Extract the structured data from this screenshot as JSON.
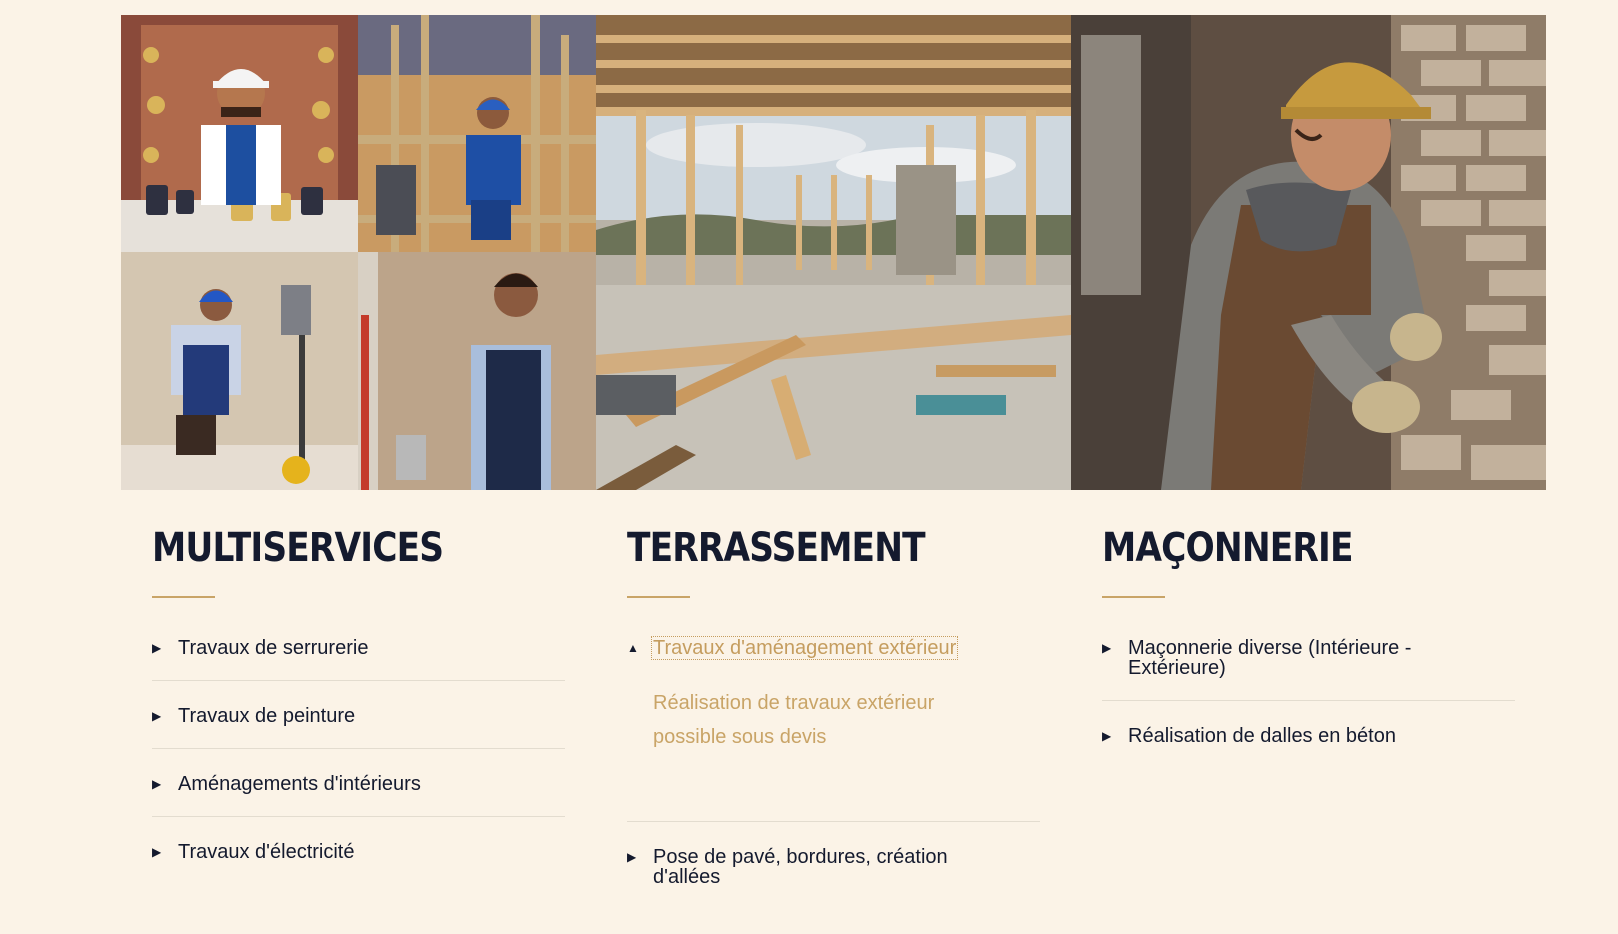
{
  "colors": {
    "background": "#fbf3e7",
    "heading": "#141a2e",
    "accent": "#c9a467",
    "separator": "#e3dccf"
  },
  "images": [
    {
      "name": "multiservices-collage-image",
      "subjects": [
        "locksmith",
        "plumber",
        "electrician",
        "painter"
      ]
    },
    {
      "name": "timber-framing-site-image",
      "subjects": [
        "wooden frame",
        "construction site"
      ]
    },
    {
      "name": "bricklayer-image",
      "subjects": [
        "mason",
        "brick wall"
      ]
    }
  ],
  "columns": [
    {
      "title": "MULTISERVICES",
      "items": [
        {
          "label": "Travaux de serrurerie",
          "open": false,
          "icon": "caret-right-icon"
        },
        {
          "label": "Travaux de peinture",
          "open": false,
          "icon": "caret-right-icon"
        },
        {
          "label": "Aménagements d'intérieurs",
          "open": false,
          "icon": "caret-right-icon"
        },
        {
          "label": "Travaux d'électricité",
          "open": false,
          "icon": "caret-right-icon"
        }
      ]
    },
    {
      "title": "TERRASSEMENT",
      "items": [
        {
          "label": "Travaux d'aménagement extérieur",
          "open": true,
          "icon": "caret-up-icon",
          "body": "Réalisation de travaux extérieur possible sous devis"
        },
        {
          "label": "Pose de pavé, bordures, création d'allées",
          "open": false,
          "icon": "caret-right-icon"
        }
      ]
    },
    {
      "title": "MAÇONNERIE",
      "items": [
        {
          "label": "Maçonnerie diverse (Intérieure - Extérieure)",
          "open": false,
          "icon": "caret-right-icon"
        },
        {
          "label": "Réalisation de dalles en béton",
          "open": false,
          "icon": "caret-right-icon"
        }
      ]
    }
  ]
}
